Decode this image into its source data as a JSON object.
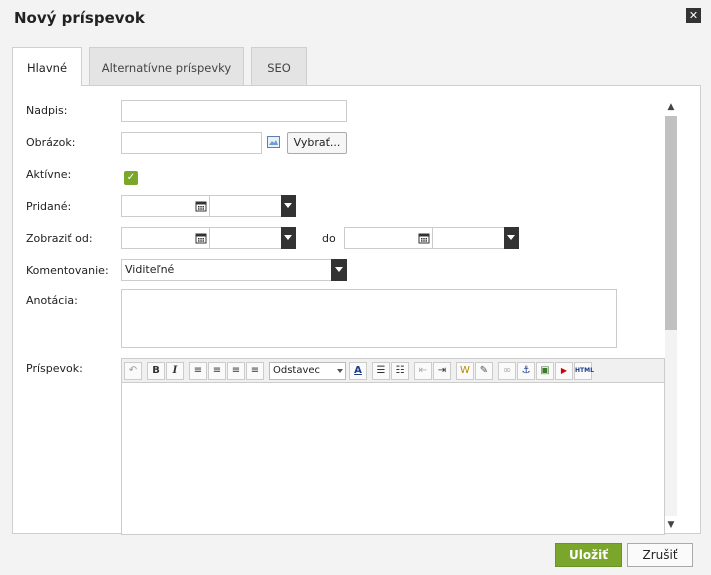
{
  "dialog": {
    "title": "Nový príspevok",
    "close": "✕"
  },
  "tabs": [
    {
      "label": "Hlavné"
    },
    {
      "label": "Alternatívne príspevky"
    },
    {
      "label": "SEO"
    }
  ],
  "form": {
    "nadpis_label": "Nadpis:",
    "nadpis_value": "",
    "obrazok_label": "Obrázok:",
    "obrazok_value": "",
    "vybrat_label": "Vybrať...",
    "aktivne_label": "Aktívne:",
    "aktivne_checked": true,
    "pridane_label": "Pridané:",
    "zobrazit_label": "Zobraziť od:",
    "do_label": "do",
    "komentovanie_label": "Komentovanie:",
    "komentovanie_value": "Viditeľné",
    "anotacia_label": "Anotácia:",
    "prispevok_label": "Príspevok:"
  },
  "editor": {
    "format_value": "Odstavec"
  },
  "colors": {
    "accent": "#7aa72b",
    "dark": "#333333"
  },
  "footer": {
    "save_label": "Uložiť",
    "cancel_label": "Zrušiť"
  }
}
